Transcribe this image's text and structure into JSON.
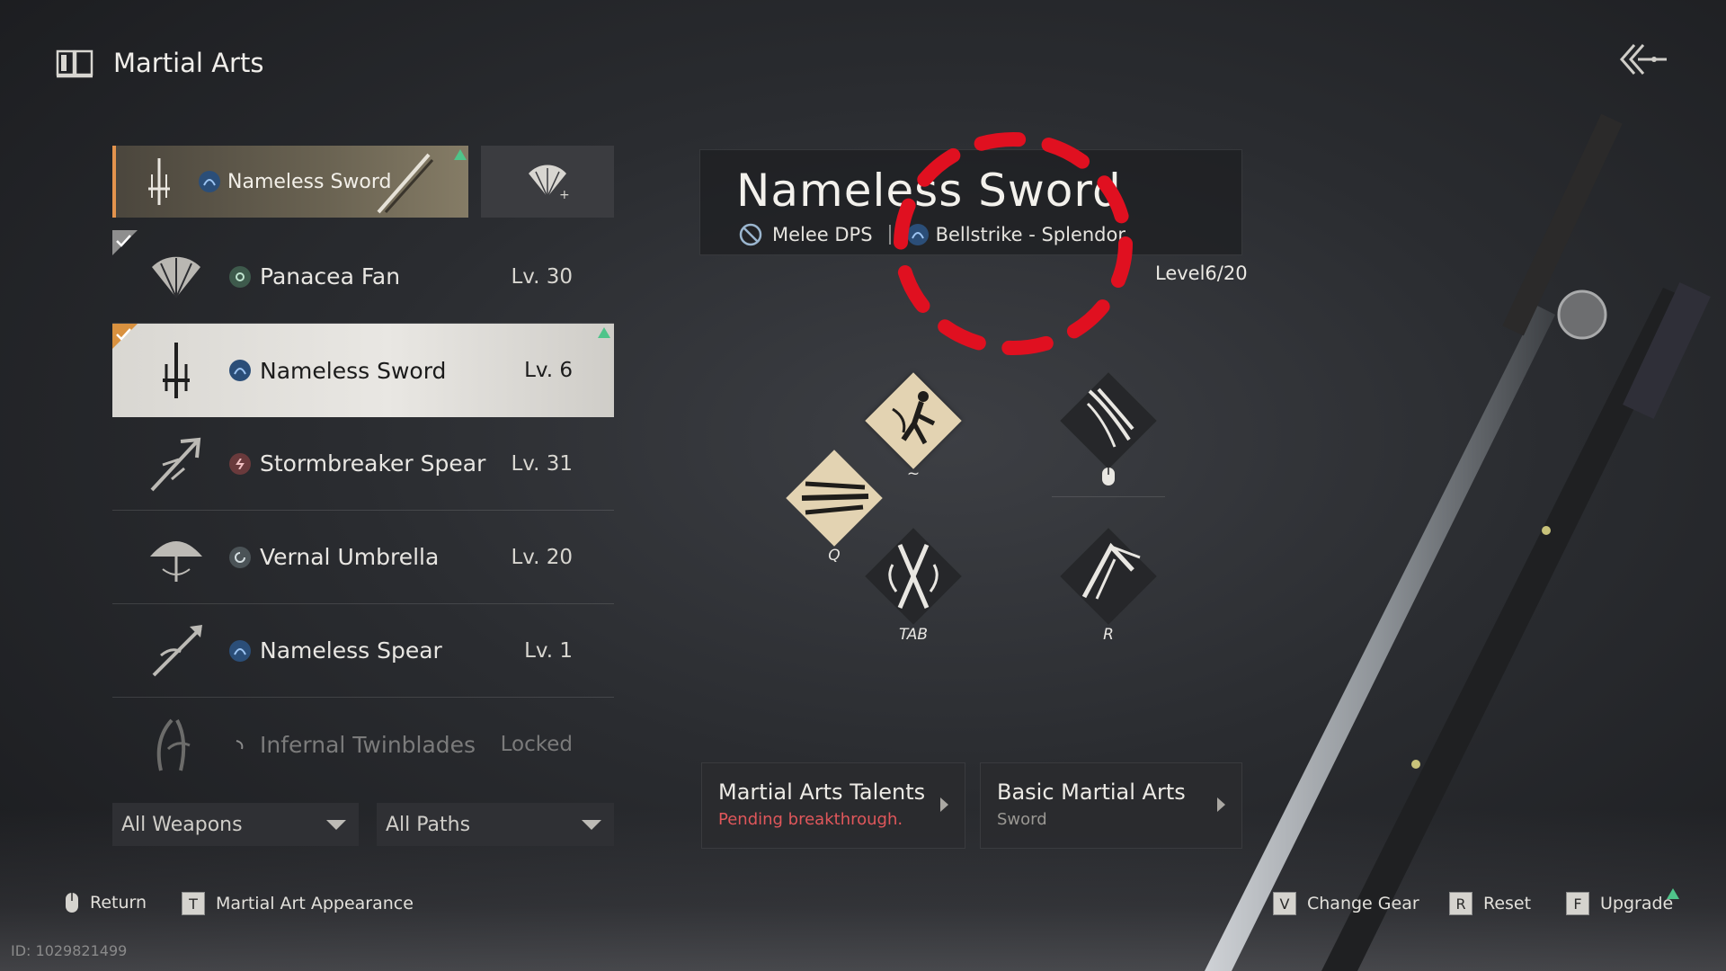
{
  "header": {
    "title": "Martial Arts",
    "icon": "book-icon",
    "back_icon": "back-arrow-icon"
  },
  "equipped": {
    "name": "Nameless Sword",
    "alt_icon": "fan-icon"
  },
  "weapons": [
    {
      "name": "Panacea Fan",
      "level": "Lv. 30",
      "icon": "fan-icon",
      "checked": true
    },
    {
      "name": "Nameless Sword",
      "level": "Lv. 6",
      "icon": "sword-icon",
      "checked": true,
      "selected": true
    },
    {
      "name": "Stormbreaker Spear",
      "level": "Lv. 31",
      "icon": "spear-icon"
    },
    {
      "name": "Vernal Umbrella",
      "level": "Lv. 20",
      "icon": "umbrella-icon"
    },
    {
      "name": "Nameless Spear",
      "level": "Lv. 1",
      "icon": "spear-icon"
    },
    {
      "name": "Infernal Twinblades",
      "level": "Locked",
      "icon": "twinblades-icon",
      "locked": true
    }
  ],
  "filters": {
    "weapons": "All Weapons",
    "paths": "All Paths"
  },
  "detail": {
    "title": "Nameless Sword",
    "role": "Melee DPS",
    "path": "Bellstrike - Splendor",
    "level": "Level6/20"
  },
  "skills": {
    "tilde_key": "~",
    "q_key": "Q",
    "tab_key": "TAB",
    "r_key": "R"
  },
  "buttons": {
    "talents_title": "Martial Arts Talents",
    "talents_sub": "Pending breakthrough.",
    "basic_title": "Basic Martial Arts",
    "basic_sub": "Sword"
  },
  "footer": {
    "return": "Return",
    "appearance_key": "T",
    "appearance": "Martial Art Appearance",
    "change_key": "V",
    "change": "Change Gear",
    "reset_key": "R",
    "reset": "Reset",
    "upgrade_key": "F",
    "upgrade": "Upgrade",
    "id": "ID: 1029821499"
  },
  "colors": {
    "accent_orange": "#e3934d",
    "upgrade_green": "#4fc48a",
    "pending_red": "#e0575b",
    "annotation_red": "#e01020"
  }
}
